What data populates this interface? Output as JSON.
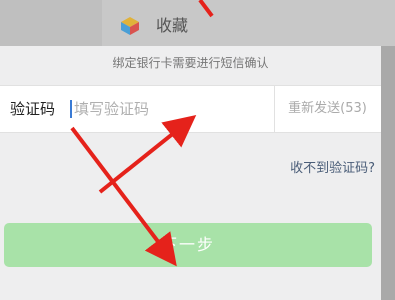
{
  "background": {
    "favorites_label": "收藏",
    "favorites_icon": "cube-icon"
  },
  "sheet": {
    "notice": "绑定银行卡需要进行短信确认",
    "code_label": "验证码",
    "code_placeholder": "填写验证码",
    "code_value": "",
    "resend_label": "重新发送(53)",
    "no_code_link": "收不到验证码?",
    "next_button": "下一步"
  },
  "colors": {
    "accent_green": "#a8e2a8",
    "link_blue": "#4a5d78",
    "annotation_red": "#e5221b"
  }
}
